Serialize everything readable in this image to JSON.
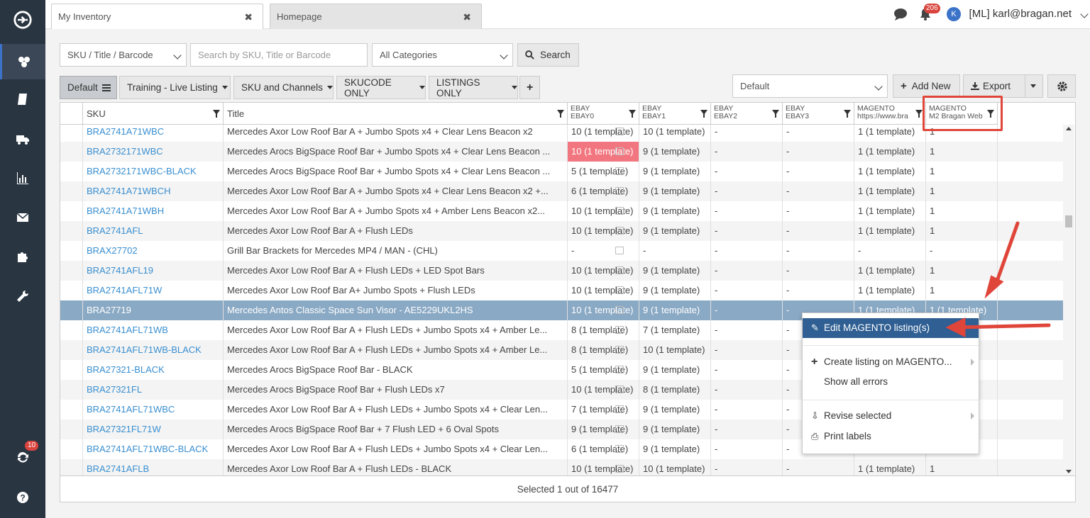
{
  "tabs": [
    {
      "label": "My Inventory",
      "close": "✖"
    },
    {
      "label": "Homepage",
      "close": "✖"
    }
  ],
  "user": {
    "avatar_letter": "K",
    "name": "[ML] karl@bragan.net",
    "notif_count": "206"
  },
  "sidebar": {
    "sync_badge": "10"
  },
  "search": {
    "mode": "SKU / Title / Barcode",
    "placeholder": "Search by SKU, Title or Barcode",
    "category": "All Categories",
    "button": "Search"
  },
  "views": [
    {
      "label": "Default"
    },
    {
      "label": "Training - Live Listing"
    },
    {
      "label": "SKU and Channels"
    },
    {
      "label": "SKUCODE ONLY"
    },
    {
      "label": "LISTINGS ONLY"
    },
    {
      "label": "+"
    }
  ],
  "toolbar": {
    "view_select": "Default",
    "add_new": "Add New",
    "export": "Export"
  },
  "columns": [
    {
      "label": "SKU"
    },
    {
      "label": "Title"
    },
    {
      "line1": "EBAY",
      "line2": "EBAY0"
    },
    {
      "line1": "EBAY",
      "line2": "EBAY1"
    },
    {
      "line1": "EBAY",
      "line2": "EBAY2"
    },
    {
      "line1": "EBAY",
      "line2": "EBAY3"
    },
    {
      "line1": "MAGENTO",
      "line2": "https://www.bra"
    },
    {
      "line1": "MAGENTO",
      "line2": "M2 Bragan Web"
    }
  ],
  "rows": [
    [
      "BRA2741A71WBC",
      "Mercedes Axor Low Roof Bar A + Jumbo Spots x4 + Clear Lens Beacon x2",
      "10 (1 template)",
      "10 (1 template)",
      "-",
      "-",
      "1 (1 template)",
      "1"
    ],
    [
      "BRA2732171WBC",
      "Mercedes Arocs BigSpace Roof Bar + Jumbo Spots x4 + Clear Lens Beacon ...",
      "10 (1 template)",
      "9 (1 template)",
      "-",
      "-",
      "1 (1 template)",
      "1"
    ],
    [
      "BRA2732171WBC-BLACK",
      "Mercedes Arocs BigSpace Roof Bar + Jumbo Spots x4 + Clear Lens Beacon ...",
      "5 (1 template)",
      "9 (1 template)",
      "-",
      "-",
      "1 (1 template)",
      "1"
    ],
    [
      "BRA2741A71WBCH",
      "Mercedes Axor Low Roof Bar A + Jumbo Spots x4 + Clear Lens Beacon x2 +...",
      "6 (1 template)",
      "9 (1 template)",
      "-",
      "-",
      "1 (1 template)",
      "1"
    ],
    [
      "BRA2741A71WBH",
      "Mercedes Axor Low Roof Bar A + Jumbo Spots x4 + Amber Lens Beacon x2...",
      "10 (1 template)",
      "9 (1 template)",
      "-",
      "-",
      "1 (1 template)",
      "1"
    ],
    [
      "BRA2741AFL",
      "Mercedes Axor Low Roof Bar A + Flush LEDs",
      "10 (1 template)",
      "9 (1 template)",
      "-",
      "-",
      "1 (1 template)",
      "1"
    ],
    [
      "BRAX27702",
      "Grill Bar Brackets for Mercedes MP4 / MAN - (CHL)",
      "-",
      "-",
      "-",
      "-",
      "-",
      "-"
    ],
    [
      "BRA2741AFL19",
      "Mercedes Axor Low Roof Bar A + Flush LEDs + LED Spot Bars",
      "10 (1 template)",
      "9 (1 template)",
      "-",
      "-",
      "1 (1 template)",
      "1"
    ],
    [
      "BRA2741AFL71W",
      "Mercedes Axor Low Roof Bar A+ Jumbo Spots + Flush LEDs",
      "10 (1 template)",
      "9 (1 template)",
      "-",
      "-",
      "1 (1 template)",
      "1"
    ],
    [
      "BRA27719",
      "Mercedes Antos Classic Space Sun Visor - AE5229UKL2HS",
      "10 (1 template)",
      "9 (1 template)",
      "-",
      "-",
      "1 (1 template)",
      "1 (1 template)"
    ],
    [
      "BRA2741AFL71WB",
      "Mercedes Axor Low Roof Bar A + Flush LEDs + Jumbo Spots x4 + Amber Le...",
      "8 (1 template)",
      "7 (1 template)",
      "-",
      "-",
      "",
      ""
    ],
    [
      "BRA2741AFL71WB-BLACK",
      "Mercedes Axor Low Roof Bar A + Flush LEDs + Jumbo Spots x4 + Amber Le...",
      "8 (1 template)",
      "10 (1 template)",
      "-",
      "-",
      "",
      ""
    ],
    [
      "BRA27321-BLACK",
      "Mercedes Arocs BigSpace Roof Bar - BLACK",
      "5 (1 template)",
      "9 (1 template)",
      "-",
      "-",
      "",
      ""
    ],
    [
      "BRA27321FL",
      "Mercedes Arocs BigSpace Roof Bar + Flush LEDs x7",
      "10 (1 template)",
      "8 (1 template)",
      "-",
      "-",
      "",
      ""
    ],
    [
      "BRA2741AFL71WBC",
      "Mercedes Axor Low Roof Bar A + Flush LEDs + Jumbo Spots x4 + Clear Len...",
      "7 (1 template)",
      "9 (1 template)",
      "-",
      "-",
      "",
      ""
    ],
    [
      "BRA27321FL71W",
      "Mercedes Arocs BigSpace Roof Bar + 7 Flush LED + 6 Oval Spots",
      "9 (1 template)",
      "9 (1 template)",
      "-",
      "-",
      "",
      ""
    ],
    [
      "BRA2741AFL71WBC-BLACK",
      "Mercedes Axor Low Roof Bar A + Flush LEDs + Jumbo Spots x4 + Clear Len...",
      "6 (1 template)",
      "9 (1 template)",
      "-",
      "-",
      "",
      ""
    ],
    [
      "BRA2741AFLB",
      "Mercedes Axor Low Roof Bar A + Flush LEDs - BLACK",
      "10 (1 template)",
      "10 (1 template)",
      "-",
      "-",
      "1 (1 template)",
      "1"
    ]
  ],
  "footer": "Selected 1 out of 16477",
  "context_menu": {
    "edit": "Edit MAGENTO listing(s)",
    "create": "Create listing on MAGENTO...",
    "errors": "Show all errors",
    "revise": "Revise selected",
    "print": "Print labels"
  },
  "colors": {
    "sidebar": "#2a3542",
    "selected_row": "#8aa9c4",
    "highlight": "#f2767f",
    "link": "#3a8fd0",
    "annotation": "#e0453a"
  }
}
